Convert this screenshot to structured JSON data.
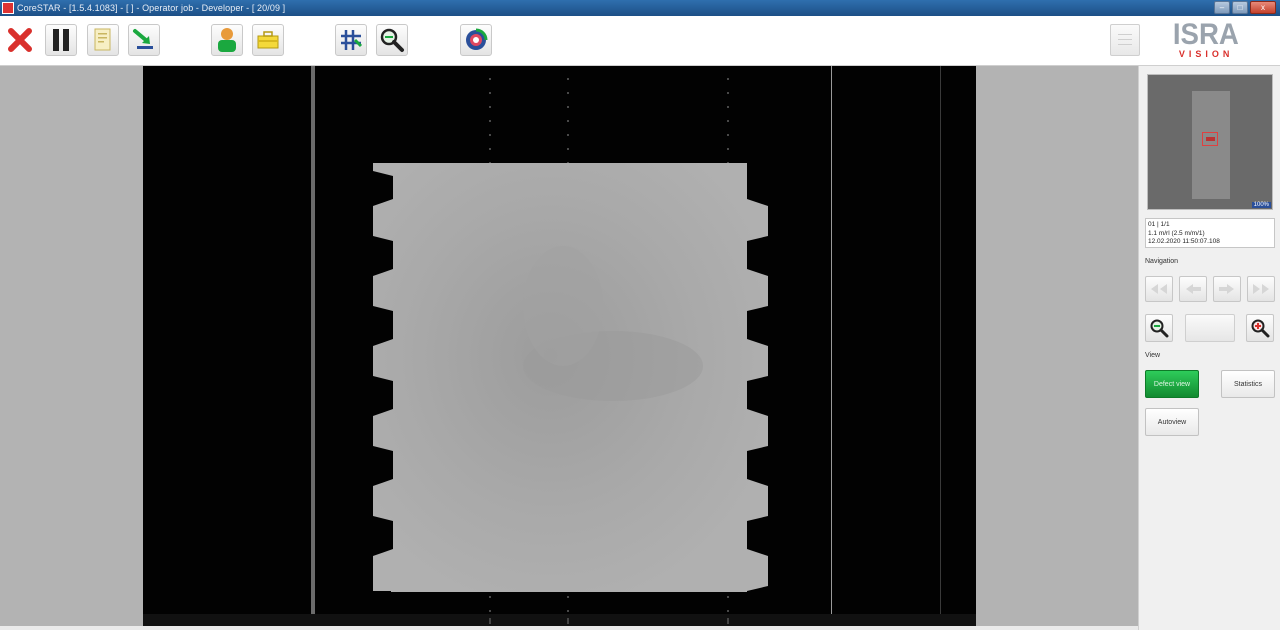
{
  "window": {
    "title": "CoreSTAR - [1.5.4.1083] - [ ] - Operator job - Developer - [ 20/09 ]"
  },
  "toolbar": {
    "icons": [
      "close-icon",
      "pause-icon",
      "report-icon",
      "export-icon",
      "user-icon",
      "toolbox-icon",
      "grid-icon",
      "zoom-icon",
      "refresh-icon"
    ],
    "accent_red": "#d9302c",
    "accent_green": "#1aa83f"
  },
  "logo": {
    "word": "ISRA",
    "sub": "VISION"
  },
  "panel": {
    "thumbnail_zoom": "100%",
    "info_lines": [
      "01 | 1/1",
      "1.1 m/rl (2.5 m/m/1)",
      "12.02.2020 11:50:07.108"
    ],
    "navigation_label": "Navigation",
    "zoom_value": "",
    "view_label": "View",
    "view_buttons": {
      "defect_view": "Defect view",
      "statistics": "Statistics",
      "autoview": "Autoview"
    }
  }
}
